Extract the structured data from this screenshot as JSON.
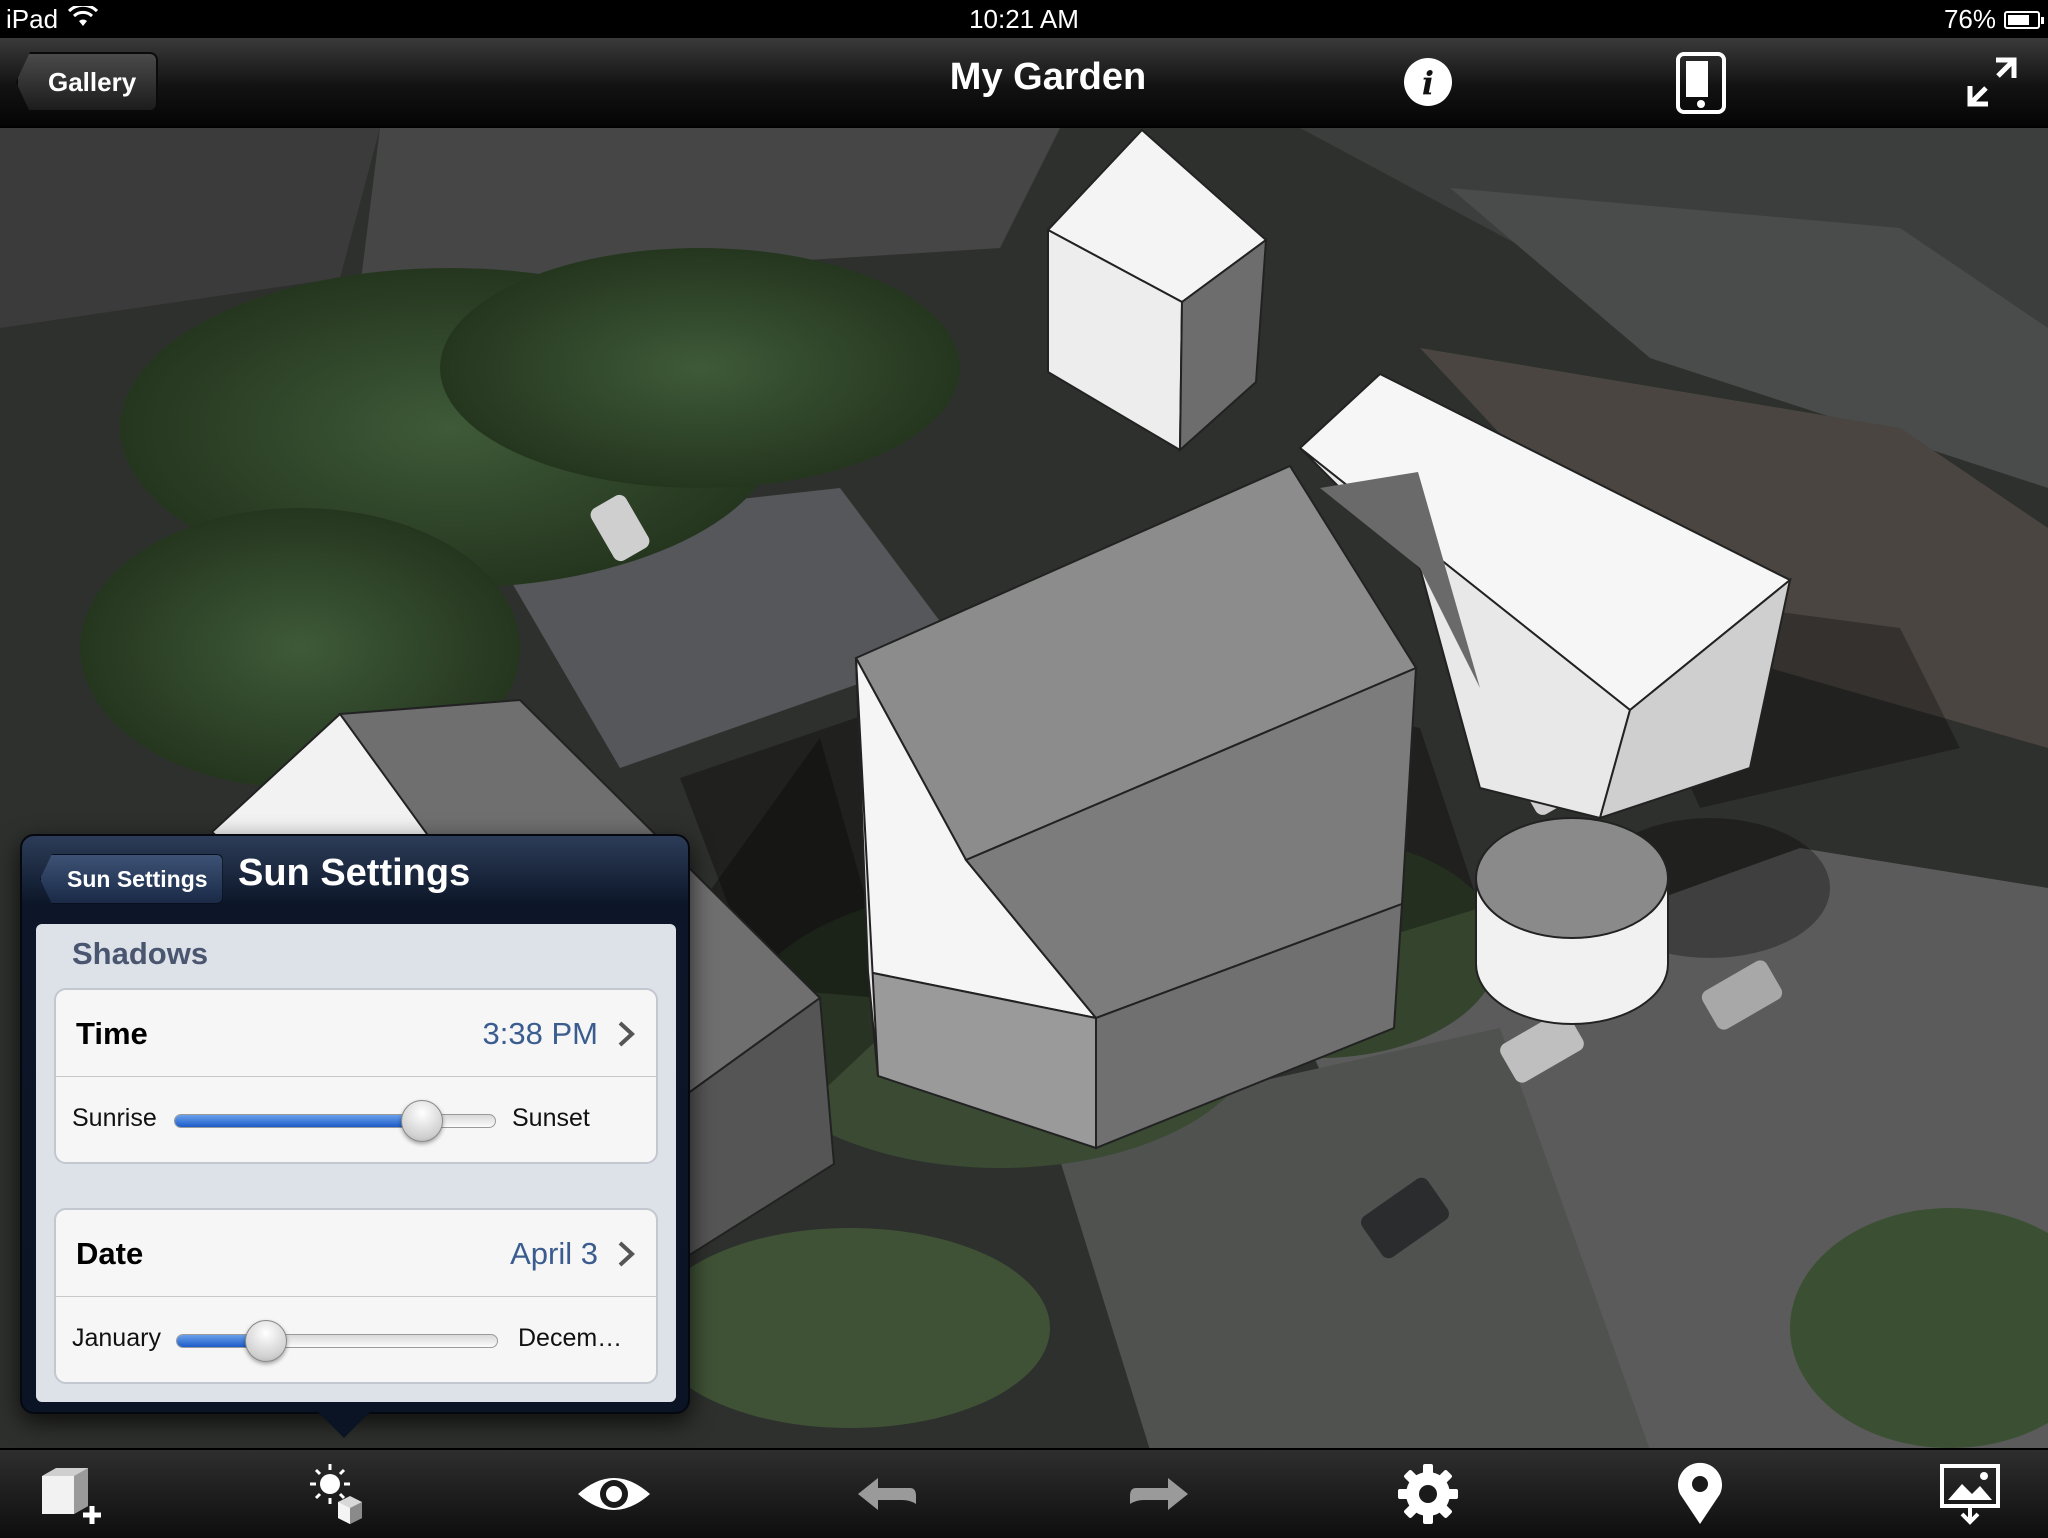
{
  "status_bar": {
    "device": "iPad",
    "time": "10:21 AM",
    "battery": "76%",
    "battery_level": 0.76
  },
  "nav": {
    "back_label": "Gallery",
    "title": "My Garden",
    "info_icon": "info-icon",
    "device_icon": "tablet-icon",
    "fullscreen_icon": "expand-icon"
  },
  "popover": {
    "back_label": "Sun Settings",
    "title": "Sun Settings",
    "section": "Shadows",
    "time": {
      "label": "Time",
      "value": "3:38 PM",
      "slider_min_label": "Sunrise",
      "slider_max_label": "Sunset",
      "slider_fraction": 0.77
    },
    "date": {
      "label": "Date",
      "value": "April 3",
      "slider_min_label": "January",
      "slider_max_label": "Decem…",
      "slider_fraction": 0.28
    }
  },
  "toolbar": {
    "items": [
      "add-model-icon",
      "sun-settings-icon",
      "view-icon",
      "undo-icon",
      "redo-icon",
      "settings-gear-icon",
      "location-pin-icon",
      "export-image-icon"
    ],
    "active": "sun-settings-icon"
  },
  "colors": {
    "link_blue": "#3a5c8f",
    "slider_fill": "#1c5cc8",
    "popover_bg": "#0a1424"
  }
}
